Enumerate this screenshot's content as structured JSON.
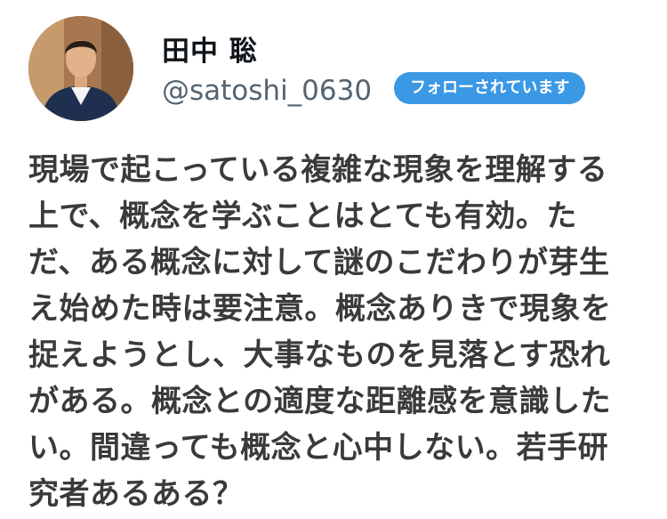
{
  "user": {
    "display_name": "田中 聡",
    "handle": "@satoshi_0630",
    "follows_badge": "フォローされています",
    "avatar_icon": "avatar-photo"
  },
  "tweet": {
    "lines": [
      "現場で起こっている複雑な現象を理解する",
      "上で、概念を学ぶことはとても有効。た",
      "だ、ある概念に対して謎のこだわりが芽生",
      "え始めた時は要注意。概念ありきで現象を",
      "捉えようとし、大事なものを見落とす恐れ",
      "がある。概念との適度な距離感を意識した",
      "い。間違っても概念と心中しない。若手研",
      "究者あるある？"
    ]
  },
  "colors": {
    "badge_background": "#3b98e5",
    "text": "#3a3a3a",
    "handle": "#536471"
  }
}
